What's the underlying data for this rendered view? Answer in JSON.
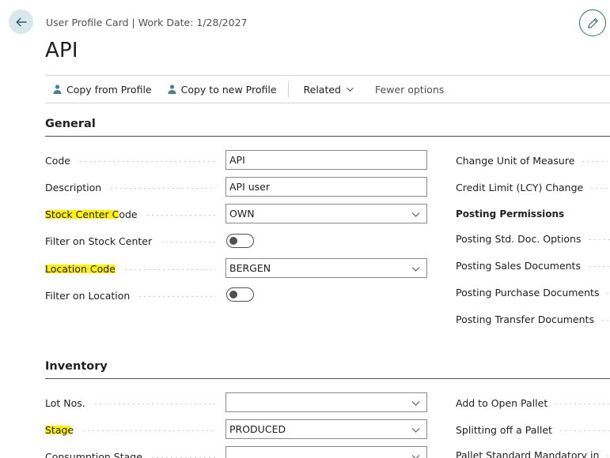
{
  "header": {
    "breadcrumb": "User Profile Card | Work Date: 1/28/2027",
    "title": "API"
  },
  "toolbar": {
    "copy_from_profile": "Copy from Profile",
    "copy_to_new_profile": "Copy to new Profile",
    "related": "Related",
    "fewer_options": "Fewer options"
  },
  "general": {
    "title": "General",
    "fields": [
      {
        "label": "Code",
        "value": "API"
      },
      {
        "label": "Description",
        "value": "API user"
      },
      {
        "label": "Stock Center Code",
        "value": "OWN"
      },
      {
        "label": "Filter on Stock Center",
        "value": false
      },
      {
        "label": "Location Code",
        "value": "BERGEN"
      },
      {
        "label": "Filter on Location",
        "value": false
      }
    ],
    "right": [
      "Change Unit of Measure",
      "Credit Limit (LCY) Change",
      "Posting Permissions",
      "Posting Std. Doc. Options",
      "Posting Sales Documents",
      "Posting Purchase Documents",
      "Posting Transfer Documents"
    ]
  },
  "inventory": {
    "title": "Inventory",
    "fields": [
      {
        "label": "Lot Nos.",
        "value": ""
      },
      {
        "label": "Stage",
        "value": "PRODUCED"
      },
      {
        "label": "Consumption Stage",
        "value": ""
      }
    ],
    "right": [
      "Add to Open Pallet",
      "Splitting off a Pallet",
      "Pallet Standard Mandatory in"
    ]
  },
  "colors": {
    "highlight": "#fff200",
    "accent": "#2f6f73"
  }
}
